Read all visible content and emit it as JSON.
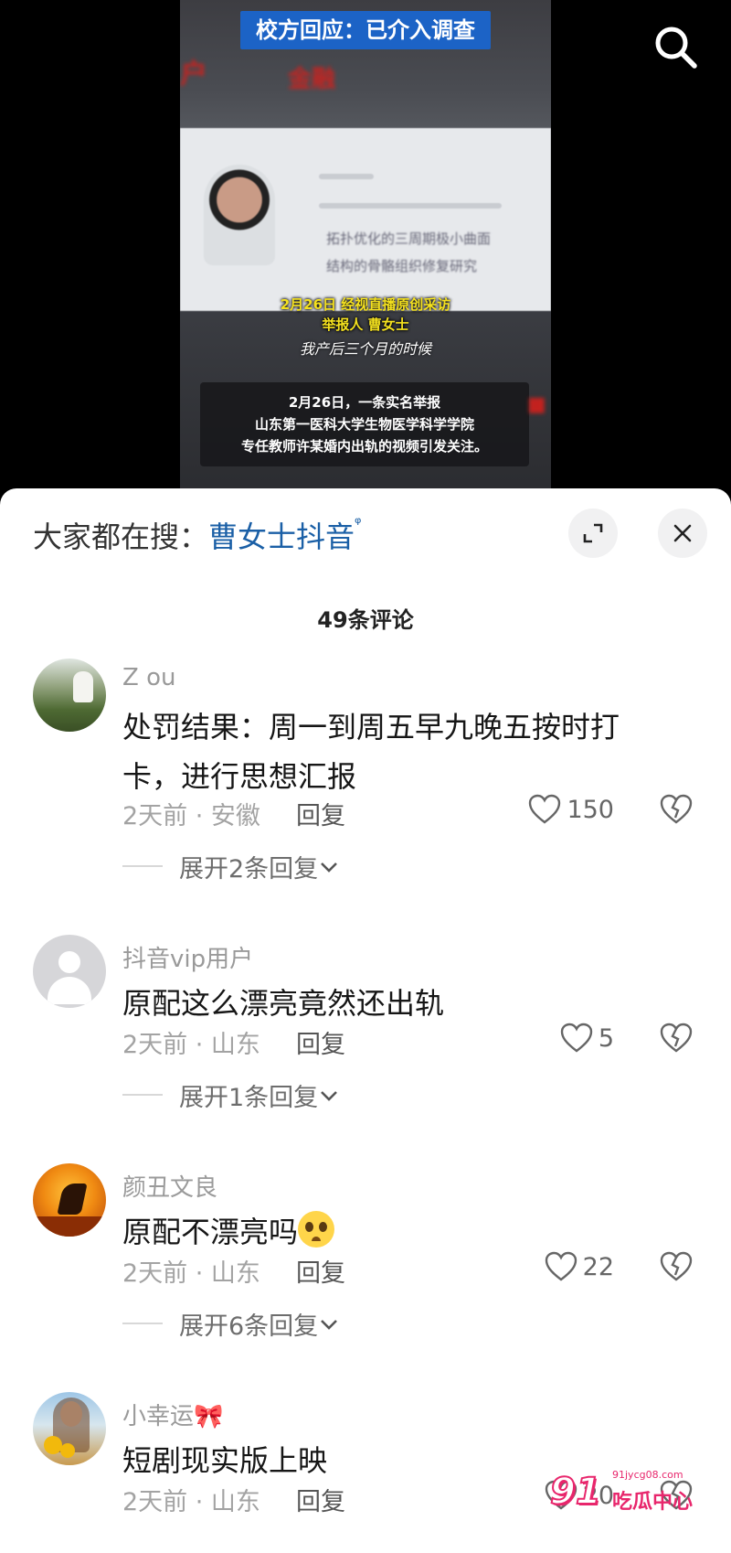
{
  "video": {
    "banner": "校方回应：已介入调查",
    "blurred_red_left": "户",
    "blurred_red_mid": "金融",
    "card_line1": "拓扑优化的三周期极小曲面",
    "card_line2": "结构的骨骼组织修复研究",
    "yellow_caption1": "2月26日 经视直播原创采访",
    "yellow_caption2": "举报人 曹女士",
    "white_caption": "我产后三个月的时候",
    "caption_box": [
      "2月26日，一条实名举报",
      "山东第一医科大学生物医学科学学院",
      "专任教师许某婚内出轨的视频引发关注。"
    ]
  },
  "sheet": {
    "hot_search_label": "大家都在搜：",
    "hot_search_keyword": "曹女士抖音",
    "count_label": "49条评论"
  },
  "comments": [
    {
      "name": "Z ou",
      "text": "处罚结果：周一到周五早九晚五按时打卡，进行思想汇报",
      "meta": "2天前 · 安徽",
      "reply": "回复",
      "likes": "150",
      "expand": "展开2条回复"
    },
    {
      "name": "抖音vip用户",
      "text": "原配这么漂亮竟然还出轨",
      "meta": "2天前 · 山东",
      "reply": "回复",
      "likes": "5",
      "expand": "展开1条回复"
    },
    {
      "name": "颜丑文良",
      "text": "原配不漂亮吗",
      "meta": "2天前 · 山东",
      "reply": "回复",
      "likes": "22",
      "expand": "展开6条回复"
    },
    {
      "name": "小幸运🎀",
      "text": "短剧现实版上映",
      "meta": "2天前 · 山东",
      "reply": "回复",
      "likes": "20"
    }
  ],
  "watermark": {
    "brand": "91",
    "url": "91jycg08.com",
    "name": "吃瓜中心"
  },
  "colors": {
    "keyword": "#1a5fa6",
    "watermark": "#e8266c",
    "banner": "#1c63c6"
  }
}
